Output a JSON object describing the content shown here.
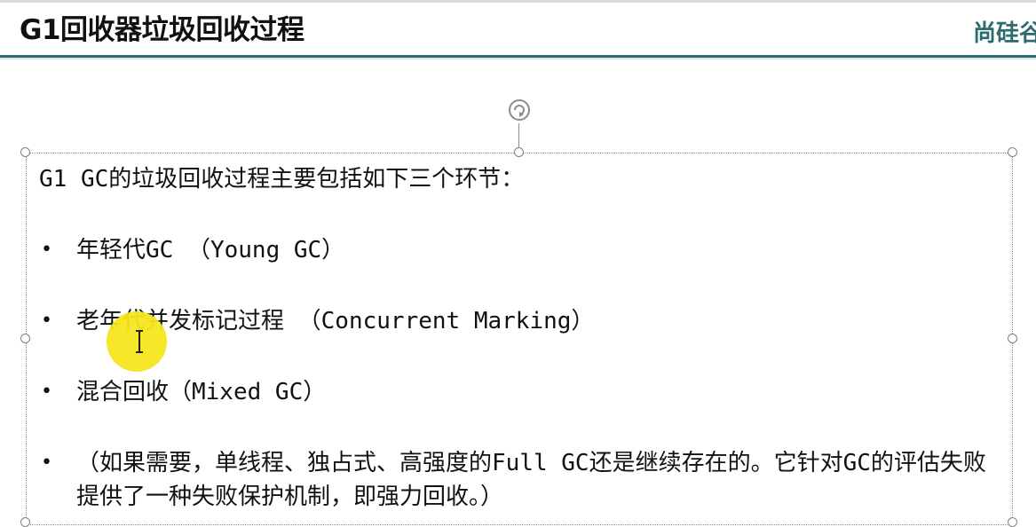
{
  "slide": {
    "title": "G1回收器垃圾回收过程",
    "logo": {
      "icon": "u-logo-icon",
      "text": "尚硅谷",
      "color": "#2d6b6e"
    },
    "accent_color": "#2e6d6f"
  },
  "content": {
    "intro": "G1 GC的垃圾回收过程主要包括如下三个环节：",
    "bullets": [
      {
        "marker": "•",
        "text": "年轻代GC （Young GC）"
      },
      {
        "marker": "•",
        "text": "老年代并发标记过程 （Concurrent Marking）"
      },
      {
        "marker": "•",
        "text": "混合回收（Mixed GC）"
      },
      {
        "marker": "•",
        "text": "（如果需要，单线程、独占式、高强度的Full GC还是继续存在的。它针对GC的评估失败提供了一种失败保护机制，即强力回收。）"
      }
    ]
  },
  "editor": {
    "rotate_icon": "rotate-handle-icon",
    "cursor_icon": "text-cursor-icon",
    "highlight_color": "#f7e61e"
  }
}
